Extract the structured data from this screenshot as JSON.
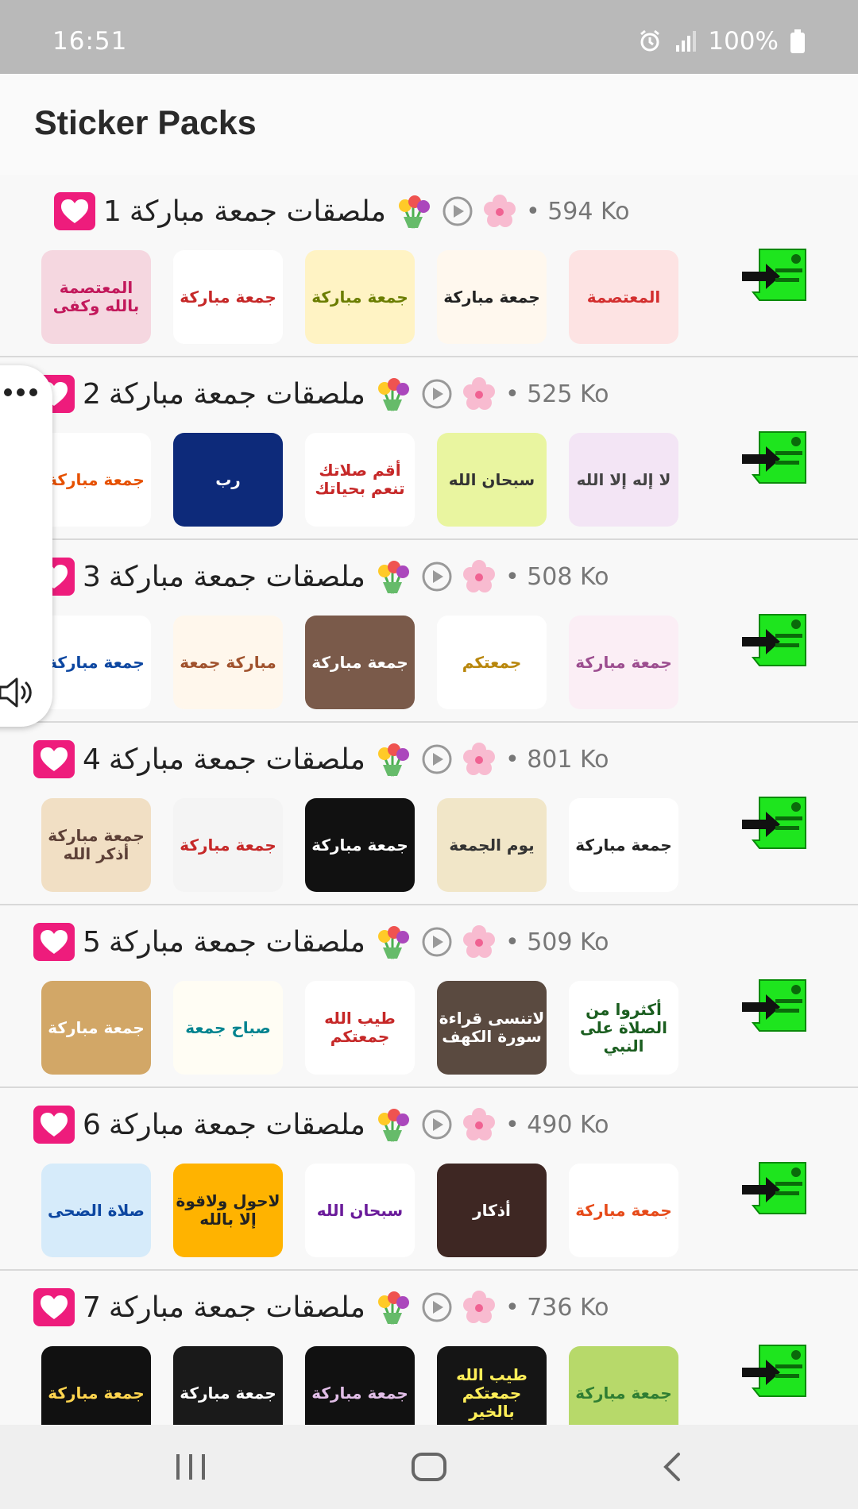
{
  "status_bar": {
    "time": "16:51",
    "battery_text": "100%"
  },
  "header": {
    "title": "Sticker Packs"
  },
  "colors": {
    "accent_heart": "#ee1c7c",
    "add_button_green": "#1ee51e",
    "status_bar_bg": "#b9b9b9"
  },
  "sticker_packs": [
    {
      "number": "1",
      "name": "ملصقات جمعة مباركة",
      "size": "594 Ko",
      "stickers": [
        {
          "text": "المعتصمة بالله وكفى",
          "bg": "#f5d7e0",
          "fg": "#c2185b"
        },
        {
          "text": "جمعة مباركة",
          "bg": "#ffffff",
          "fg": "#c62828"
        },
        {
          "text": "جمعة مباركة",
          "bg": "#fff3c4",
          "fg": "#6b7d00"
        },
        {
          "text": "جمعة مباركة",
          "bg": "#fff8ee",
          "fg": "#222222"
        },
        {
          "text": "المعتصمة",
          "bg": "#fde3e3",
          "fg": "#d32f2f"
        }
      ]
    },
    {
      "number": "2",
      "name": "ملصقات جمعة مباركة",
      "size": "525 Ko",
      "stickers": [
        {
          "text": "جمعة مباركة",
          "bg": "#ffffff",
          "fg": "#e65100"
        },
        {
          "text": "رب",
          "bg": "#0d2a7a",
          "fg": "#ffffff"
        },
        {
          "text": "أقم صلاتك تنعم بحياتك",
          "bg": "#ffffff",
          "fg": "#c62828"
        },
        {
          "text": "سبحان الله",
          "bg": "#e9f5a0",
          "fg": "#333333"
        },
        {
          "text": "لا إله إلا الله",
          "bg": "#f3e5f5",
          "fg": "#444444"
        }
      ]
    },
    {
      "number": "3",
      "name": "ملصقات جمعة مباركة",
      "size": "508 Ko",
      "stickers": [
        {
          "text": "جمعة مباركة",
          "bg": "#ffffff",
          "fg": "#0d47a1"
        },
        {
          "text": "مباركة جمعة",
          "bg": "#fff7ec",
          "fg": "#a0522d"
        },
        {
          "text": "جمعة مباركة",
          "bg": "#7a5a4a",
          "fg": "#ffffff"
        },
        {
          "text": "جمعتكم",
          "bg": "#ffffff",
          "fg": "#b8860b"
        },
        {
          "text": "جمعة مباركة",
          "bg": "#fbeef5",
          "fg": "#9c4d8f"
        }
      ]
    },
    {
      "number": "4",
      "name": "ملصقات جمعة مباركة",
      "size": "801 Ko",
      "stickers": [
        {
          "text": "جمعة مباركة أذكر الله",
          "bg": "#f1dfc4",
          "fg": "#5d4037"
        },
        {
          "text": "جمعة مباركة",
          "bg": "#f4f4f4",
          "fg": "#c62828"
        },
        {
          "text": "جمعة مباركة",
          "bg": "#111111",
          "fg": "#ffffff"
        },
        {
          "text": "يوم الجمعة",
          "bg": "#f1e6c8",
          "fg": "#333333"
        },
        {
          "text": "جمعة مباركة",
          "bg": "#ffffff",
          "fg": "#222222"
        }
      ]
    },
    {
      "number": "5",
      "name": "ملصقات جمعة مباركة",
      "size": "509 Ko",
      "stickers": [
        {
          "text": "جمعة مباركة",
          "bg": "#d2a767",
          "fg": "#ffffff"
        },
        {
          "text": "صباح جمعة",
          "bg": "#fffdf4",
          "fg": "#00838f"
        },
        {
          "text": "طيب الله جمعتكم",
          "bg": "#ffffff",
          "fg": "#c62828"
        },
        {
          "text": "لاتنسى قراءة سورة الكهف",
          "bg": "#5a4a40",
          "fg": "#ffffff"
        },
        {
          "text": "أكثروا من الصلاة على النبي",
          "bg": "#ffffff",
          "fg": "#1b5e20"
        }
      ]
    },
    {
      "number": "6",
      "name": "ملصقات جمعة مباركة",
      "size": "490 Ko",
      "stickers": [
        {
          "text": "صلاة الضحى",
          "bg": "#d6ebfa",
          "fg": "#0d47a1"
        },
        {
          "text": "لاحول ولاقوة إلا بالله",
          "bg": "#ffb300",
          "fg": "#222222"
        },
        {
          "text": "سبحان الله",
          "bg": "#ffffff",
          "fg": "#6a1b9a"
        },
        {
          "text": "أذكار",
          "bg": "#3e2723",
          "fg": "#ffffff"
        },
        {
          "text": "جمعة مباركة",
          "bg": "#ffffff",
          "fg": "#e64a19"
        }
      ]
    },
    {
      "number": "7",
      "name": "ملصقات جمعة مباركة",
      "size": "736 Ko",
      "stickers": [
        {
          "text": "جمعة مباركة",
          "bg": "#111111",
          "fg": "#ffd54f"
        },
        {
          "text": "جمعة مباركة",
          "bg": "#1a1a1a",
          "fg": "#ffffff"
        },
        {
          "text": "جمعة مباركة",
          "bg": "#111111",
          "fg": "#e1bee7"
        },
        {
          "text": "طيب الله جمعتكم بالخير",
          "bg": "#151515",
          "fg": "#ffee58"
        },
        {
          "text": "جمعة مباركة",
          "bg": "#b7d96a",
          "fg": "#2e7d32"
        }
      ]
    }
  ]
}
